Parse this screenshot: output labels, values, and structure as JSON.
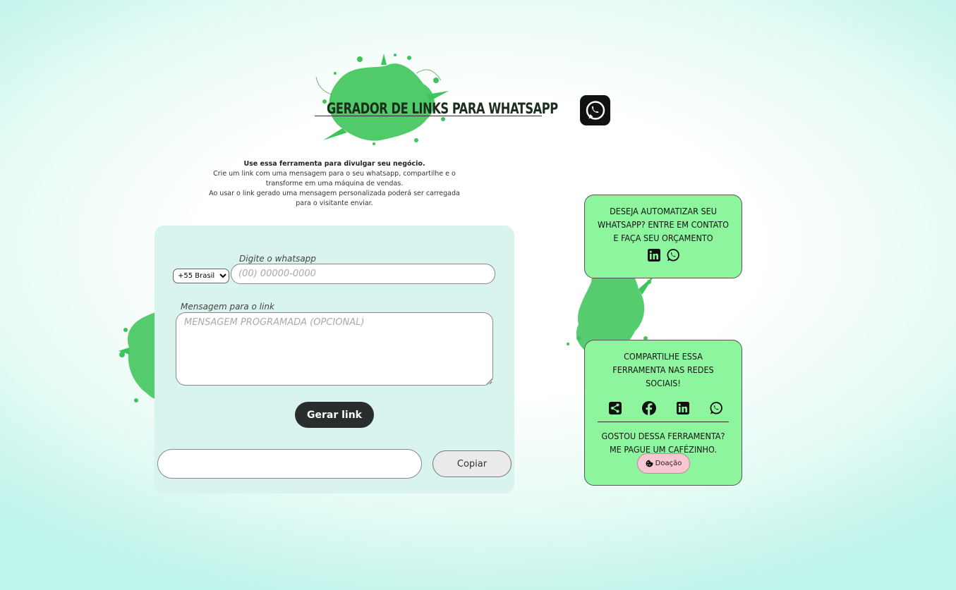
{
  "header": {
    "title": "GERADOR DE LINKS PARA WHATSAPP",
    "logo_icon": "whatsapp-icon"
  },
  "intro": {
    "lead": "Use essa ferramenta para divulgar seu negócio.",
    "line1": "Crie um link com uma mensagem para o seu whatsapp, compartilhe e o transforme em uma máquina de vendas.",
    "line2": "Ao usar o link gerado uma mensagem personalizada poderá ser carregada para o visitante enviar."
  },
  "form": {
    "phone_label": "Digite o whatsapp",
    "country_selected": "+55 Brasil",
    "phone_placeholder": "(00) 00000-0000",
    "message_label": "Mensagem para o link",
    "message_placeholder": "MENSAGEM PROGRAMADA (OPCIONAL)",
    "generate_label": "Gerar link",
    "result_value": "",
    "copy_label": "Copiar"
  },
  "contact_card": {
    "text": "Deseja automatizar seu WhatsApp? Entre em contato e faça seu orçamento",
    "icons": [
      "linkedin-icon",
      "whatsapp-icon"
    ]
  },
  "share_card": {
    "text": "Compartilhe essa ferramenta nas redes sociais!",
    "icons": [
      "share-icon",
      "facebook-icon",
      "linkedin-icon",
      "whatsapp-icon"
    ],
    "donate_text": "Gostou dessa ferramenta? Me pague um cafézinho.",
    "donate_label": "Doação",
    "donate_icon": "cookie-icon"
  },
  "colors": {
    "card_green": "#8ef59f",
    "form_bg": "#d9f3ee",
    "splash_green": "#3ec55a",
    "button_dark": "#2a2d2d",
    "donate_pink": "#f8c7d3"
  }
}
